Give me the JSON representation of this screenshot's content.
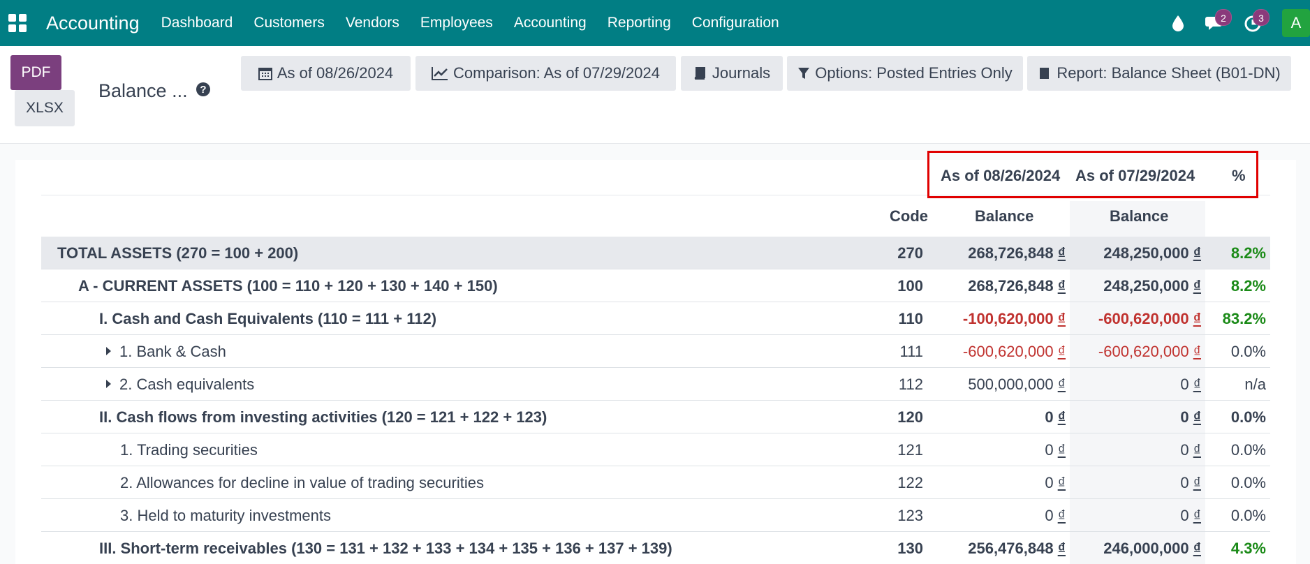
{
  "navbar": {
    "brand": "Accounting",
    "menu": [
      "Dashboard",
      "Customers",
      "Vendors",
      "Employees",
      "Accounting",
      "Reporting",
      "Configuration"
    ],
    "messages_count": "2",
    "activities_count": "3",
    "avatar_initial": "A"
  },
  "control_panel": {
    "pdf_label": "PDF",
    "xlsx_label": "XLSX",
    "title": "Balance ...",
    "filters": {
      "date": "As of 08/26/2024",
      "comparison": "Comparison: As of 07/29/2024",
      "journals": "Journals",
      "options": "Options: Posted Entries Only",
      "report": "Report: Balance Sheet (B01-DN)"
    }
  },
  "table": {
    "period_headers": [
      "As of 08/26/2024",
      "As of 07/29/2024",
      "%"
    ],
    "col_headers": {
      "code": "Code",
      "balance1": "Balance",
      "balance2": "Balance"
    },
    "rows": [
      {
        "label": "TOTAL ASSETS (270 = 100 + 200)",
        "code": "270",
        "bal1": "268,726,848",
        "bal2": "248,250,000",
        "pct": "8.2%"
      },
      {
        "label": "A - CURRENT ASSETS (100 = 110 + 120 + 130 + 140 + 150)",
        "code": "100",
        "bal1": "268,726,848",
        "bal2": "248,250,000",
        "pct": "8.2%"
      },
      {
        "label": "I. Cash and Cash Equivalents (110 = 111 + 112)",
        "code": "110",
        "bal1": "-100,620,000",
        "bal2": "-600,620,000",
        "pct": "83.2%"
      },
      {
        "label": "1. Bank & Cash",
        "code": "111",
        "bal1": "-600,620,000",
        "bal2": "-600,620,000",
        "pct": "0.0%"
      },
      {
        "label": "2. Cash equivalents",
        "code": "112",
        "bal1": "500,000,000",
        "bal2": "0",
        "pct": "n/a"
      },
      {
        "label": "II. Cash flows from investing activities (120 = 121 + 122 + 123)",
        "code": "120",
        "bal1": "0",
        "bal2": "0",
        "pct": "0.0%"
      },
      {
        "label": "1. Trading securities",
        "code": "121",
        "bal1": "0",
        "bal2": "0",
        "pct": "0.0%"
      },
      {
        "label": "2. Allowances for decline in value of trading securities",
        "code": "122",
        "bal1": "0",
        "bal2": "0",
        "pct": "0.0%"
      },
      {
        "label": "3. Held to maturity investments",
        "code": "123",
        "bal1": "0",
        "bal2": "0",
        "pct": "0.0%"
      },
      {
        "label": "III. Short-term receivables (130 = 131 + 132 + 133 + 134 + 135 + 136 + 137 + 139)",
        "code": "130",
        "bal1": "256,476,848",
        "bal2": "246,000,000",
        "pct": "4.3%"
      }
    ],
    "currency_symbol": "₫"
  },
  "colors": {
    "navbar": "#017e84",
    "pdf": "#7b3f7e",
    "negative": "#c0322f",
    "positive": "#1a8a17",
    "highlight": "#e00000"
  }
}
